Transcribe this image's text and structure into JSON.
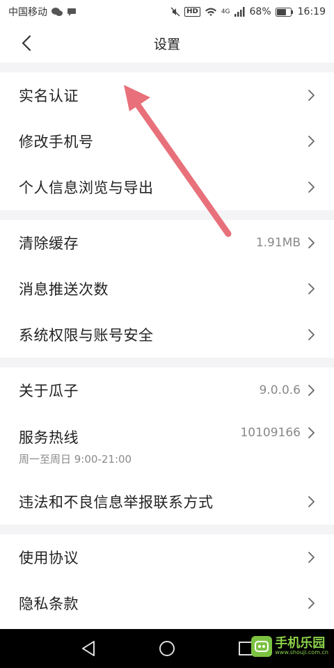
{
  "status_bar": {
    "carrier": "中国移动",
    "hd_badge": "HD",
    "network": "4G",
    "battery": "68%",
    "battery_level": 0.68,
    "time": "16:19"
  },
  "header": {
    "title": "设置"
  },
  "groups": [
    {
      "items": [
        {
          "label": "实名认证"
        },
        {
          "label": "修改手机号"
        },
        {
          "label": "个人信息浏览与导出"
        }
      ]
    },
    {
      "items": [
        {
          "label": "清除缓存",
          "value": "1.91MB"
        },
        {
          "label": "消息推送次数"
        },
        {
          "label": "系统权限与账号安全"
        }
      ]
    },
    {
      "items": [
        {
          "label": "关于瓜子",
          "value": "9.0.0.6"
        },
        {
          "label": "服务热线",
          "value": "10109166",
          "sub": "周一至周日 9:00-21:00"
        },
        {
          "label": "违法和不良信息举报联系方式"
        }
      ]
    },
    {
      "items": [
        {
          "label": "使用协议"
        },
        {
          "label": "隐私条款"
        }
      ]
    }
  ],
  "annotation": {
    "color": "#e8707a"
  },
  "watermark": {
    "main": "手机乐园",
    "url": "www.shouji.com.cn"
  }
}
